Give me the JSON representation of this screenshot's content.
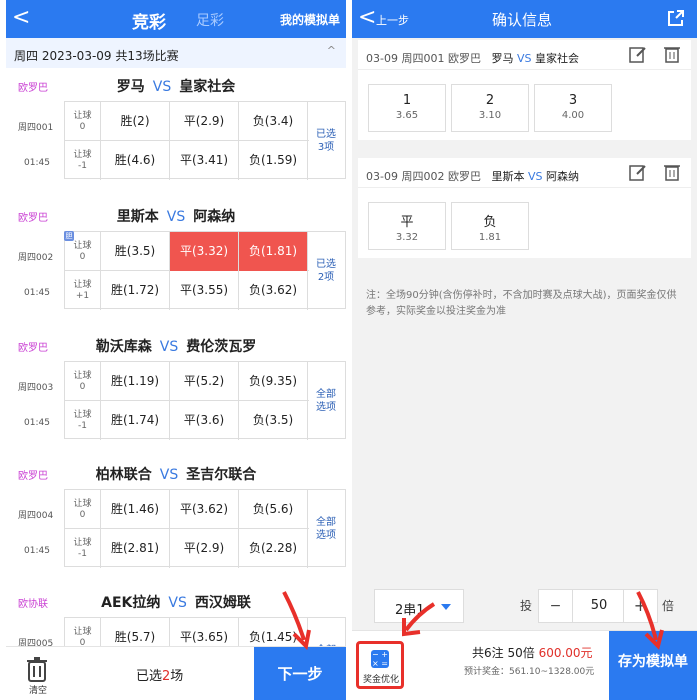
{
  "left": {
    "header": {
      "back": "<",
      "title": "竞彩",
      "alt_tab": "足彩",
      "my_sim": "我的模拟单"
    },
    "datebar": {
      "text": "周四 2023-03-09 共13场比赛",
      "caret": "^"
    },
    "matches": [
      {
        "league": "欧罗巴",
        "home": "罗马",
        "vs": "VS",
        "away": "皇家社会",
        "code": "周四001",
        "time": "01:45",
        "rq1": "让球\n0",
        "rq2": "让球\n-1",
        "r1": [
          "胜(2)",
          "平(2.9)",
          "负(3.4)"
        ],
        "r2": [
          "胜(4.6)",
          "平(3.41)",
          "负(1.59)"
        ],
        "side": "已选\n3项"
      },
      {
        "league": "欧罗巴",
        "home": "里斯本",
        "vs": "VS",
        "away": "阿森纳",
        "code": "周四002",
        "time": "01:45",
        "dan": "胆",
        "rq1": "让球\n0",
        "rq2": "让球\n+1",
        "r1": [
          "胜(3.5)",
          "平(3.32)",
          "负(1.81)"
        ],
        "r2": [
          "胜(1.72)",
          "平(3.55)",
          "负(3.62)"
        ],
        "side": "已选\n2项"
      },
      {
        "league": "欧罗巴",
        "home": "勒沃库森",
        "vs": "VS",
        "away": "费伦茨瓦罗",
        "code": "周四003",
        "time": "01:45",
        "rq1": "让球\n0",
        "rq2": "让球\n-1",
        "r1": [
          "胜(1.19)",
          "平(5.2)",
          "负(9.35)"
        ],
        "r2": [
          "胜(1.74)",
          "平(3.6)",
          "负(3.5)"
        ],
        "side": "全部\n选项"
      },
      {
        "league": "欧罗巴",
        "home": "柏林联合",
        "vs": "VS",
        "away": "圣吉尔联合",
        "code": "周四004",
        "time": "01:45",
        "rq1": "让球\n0",
        "rq2": "让球\n-1",
        "r1": [
          "胜(1.46)",
          "平(3.62)",
          "负(5.6)"
        ],
        "r2": [
          "胜(2.81)",
          "平(2.9)",
          "负(2.28)"
        ],
        "side": "全部\n选项"
      },
      {
        "league": "欧协联",
        "home": "AEK拉纳",
        "vs": "VS",
        "away": "西汉姆联",
        "code": "周四005",
        "time": "",
        "rq1": "让球\n0",
        "rq2": "",
        "r1": [
          "胜(5.7)",
          "平(3.65)",
          "负(1.45)"
        ],
        "r2": [
          "",
          "",
          ""
        ],
        "side": "全部"
      }
    ],
    "footer": {
      "clear": "清空",
      "selected_prefix": "已选",
      "selected_count": "2",
      "selected_suffix": "场",
      "next": "下一步"
    }
  },
  "right": {
    "header": {
      "back": "<",
      "prev": "上一步",
      "title": "确认信息"
    },
    "cards": [
      {
        "head": "03-09 周四001 欧罗巴",
        "home": "罗马",
        "vs": "VS",
        "away": "皇家社会",
        "options": [
          {
            "a": "1",
            "b": "3.65"
          },
          {
            "a": "2",
            "b": "3.10"
          },
          {
            "a": "3",
            "b": "4.00"
          }
        ]
      },
      {
        "head": "03-09 周四002 欧罗巴",
        "home": "里斯本",
        "vs": "VS",
        "away": "阿森纳",
        "options": [
          {
            "a": "平",
            "b": "3.32"
          },
          {
            "a": "负",
            "b": "1.81"
          }
        ]
      }
    ],
    "note": "注：全场90分钟(含伤停补时，不含加时赛及点球大战)，页面奖金仅供参考，实际奖金以投注奖金为准",
    "controls": {
      "chuan": "2串1",
      "tou": "投",
      "minus": "−",
      "value": "50",
      "plus": "+",
      "bei": "倍"
    },
    "footer": {
      "optimize": "奖金优化",
      "summary_prefix": "共6注 50倍",
      "amount": "600.00元",
      "prize": "预计奖金：561.10~1328.00元",
      "save": "存为模拟单"
    }
  },
  "colors": {
    "brand": "#2b7af0",
    "selected": "#f0554f",
    "league": "#c93fd3",
    "highlight": "#e8302a"
  }
}
